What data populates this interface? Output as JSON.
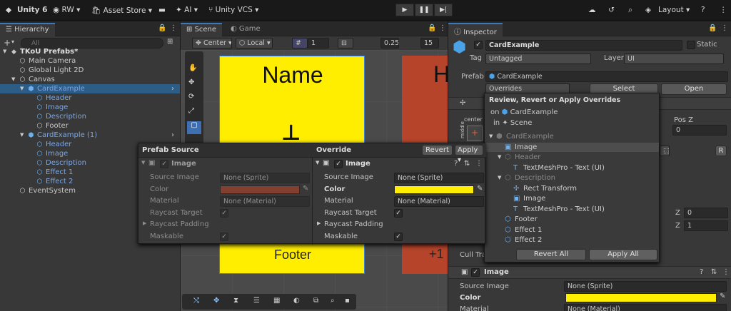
{
  "toolbar": {
    "app_title": "Unity 6",
    "account": "RW",
    "asset_store": "Asset Store",
    "ai": "AI",
    "vcs": "Unity VCS",
    "layout": "Layout",
    "play": "▶",
    "pause": "❚❚",
    "step": "▶|"
  },
  "hierarchy": {
    "tab": "Hierarchy",
    "search_placeholder": "All",
    "items": [
      {
        "label": "TKoU Prefabs*",
        "icon": "◆",
        "indent": 0,
        "arrow": "▼",
        "bold": true
      },
      {
        "label": "Main Camera",
        "icon": "⬡",
        "indent": 1
      },
      {
        "label": "Global Light 2D",
        "icon": "⬡",
        "indent": 1
      },
      {
        "label": "Canvas",
        "icon": "⬡",
        "indent": 1,
        "arrow": "▼"
      },
      {
        "label": "CardExample",
        "icon": "⬢",
        "indent": 2,
        "arrow": "▼",
        "blue": true,
        "selected": true
      },
      {
        "label": "Header",
        "icon": "⬡",
        "indent": 3,
        "blue": true
      },
      {
        "label": "Image",
        "icon": "⬡",
        "indent": 3,
        "blue": true
      },
      {
        "label": "Description",
        "icon": "⬡",
        "indent": 3,
        "blue": true
      },
      {
        "label": "Footer",
        "icon": "⬡",
        "indent": 3
      },
      {
        "label": "CardExample (1)",
        "icon": "⬢",
        "indent": 2,
        "arrow": "▼",
        "blue": true
      },
      {
        "label": "Header",
        "icon": "⬡",
        "indent": 3,
        "blue": true
      },
      {
        "label": "Image",
        "icon": "⬡",
        "indent": 3,
        "blue": true
      },
      {
        "label": "Description",
        "icon": "⬡",
        "indent": 3,
        "blue": true
      },
      {
        "label": "Effect 1",
        "icon": "⬡",
        "indent": 3,
        "blue": true
      },
      {
        "label": "Effect 2",
        "icon": "⬡",
        "indent": 3,
        "blue": true
      },
      {
        "label": "EventSystem",
        "icon": "⬡",
        "indent": 1
      }
    ]
  },
  "scene": {
    "tab_scene": "Scene",
    "tab_game": "Game",
    "pivot": "Center",
    "space": "Local",
    "grid_count": "1",
    "snap": "0.25",
    "num": "15",
    "card_title": "Name",
    "card_footer": "Footer",
    "card2_letter": "H",
    "card2_footer": "+1"
  },
  "compare": {
    "left_title": "Prefab Source",
    "right_title": "Override",
    "revert": "Revert",
    "apply": "Apply",
    "component": "Image",
    "rows": [
      {
        "label": "Source Image",
        "value": "None (Sprite)"
      },
      {
        "label": "Color",
        "left_color": "#b5442a",
        "right_color": "#ffee00"
      },
      {
        "label": "Material",
        "value": "None (Material)"
      },
      {
        "label": "Raycast Target"
      },
      {
        "label": "Raycast Padding"
      },
      {
        "label": "Maskable"
      }
    ]
  },
  "inspector": {
    "tab": "Inspector",
    "name": "CardExample",
    "static": "Static",
    "tag_label": "Tag",
    "tag": "Untagged",
    "layer_label": "Layer",
    "layer": "UI",
    "prefab_label": "Prefab",
    "prefab": "CardExample",
    "overrides": "Overrides",
    "select": "Select",
    "open": "Open",
    "center": "center",
    "middle": "middle",
    "posz": "Pos Z",
    "z0": "0",
    "zlabel1": "Z",
    "z1v": "0",
    "zlabel2": "Z",
    "z2v": "1",
    "cull": "Cull Tra",
    "image_header": "Image",
    "source_image_label": "Source Image",
    "source_image": "None (Sprite)",
    "color_label": "Color",
    "material_label": "Material",
    "material": "None (Material)",
    "color": "#ffee00",
    "r_btn": "R"
  },
  "popup": {
    "title": "Review, Revert or Apply Overrides",
    "on": "on",
    "on_target": "CardExample",
    "in": "in",
    "in_target": "Scene",
    "tree": [
      {
        "label": "CardExample",
        "indent": 0,
        "arrow": "▼",
        "dim": true,
        "icon": "⬢"
      },
      {
        "label": "Image",
        "indent": 1,
        "selected": true,
        "icon": "▣"
      },
      {
        "label": "Header",
        "indent": 1,
        "arrow": "▼",
        "dim": true,
        "icon": "⬡"
      },
      {
        "label": "TextMeshPro - Text (UI)",
        "indent": 2,
        "icon": "T"
      },
      {
        "label": "Description",
        "indent": 1,
        "arrow": "▼",
        "dim": true,
        "icon": "⬡"
      },
      {
        "label": "Rect Transform",
        "indent": 2,
        "icon": "✢"
      },
      {
        "label": "Image",
        "indent": 2,
        "icon": "▣"
      },
      {
        "label": "TextMeshPro - Text (UI)",
        "indent": 2,
        "icon": "T"
      },
      {
        "label": "Footer",
        "indent": 1,
        "icon": "⬡"
      },
      {
        "label": "Effect 1",
        "indent": 1,
        "icon": "⬡"
      },
      {
        "label": "Effect 2",
        "indent": 1,
        "icon": "⬡"
      }
    ],
    "revert_all": "Revert All",
    "apply_all": "Apply All"
  }
}
